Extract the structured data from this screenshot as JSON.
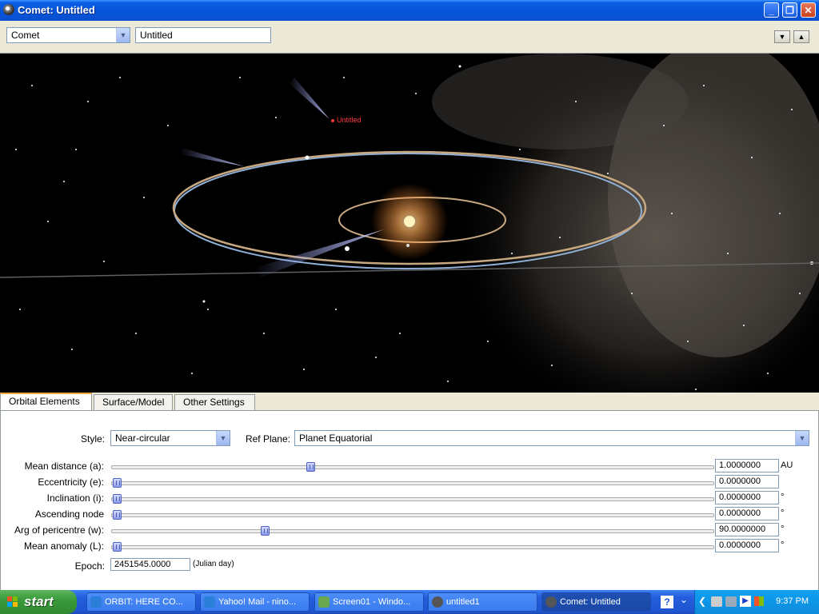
{
  "window": {
    "title": "Comet: Untitled"
  },
  "toolbar": {
    "type_value": "Comet",
    "name_value": "Untitled"
  },
  "viewport": {
    "comet_label": "Untitled"
  },
  "tabs": [
    "Orbital Elements",
    "Surface/Model",
    "Other Settings"
  ],
  "panel": {
    "style_label": "Style:",
    "style_value": "Near-circular",
    "ref_plane_label": "Ref Plane:",
    "ref_plane_value": "Planet Equatorial",
    "elements": [
      {
        "label": "Mean distance (a):",
        "value": "1.0000000",
        "unit": "AU",
        "slider_fraction": 0.327
      },
      {
        "label": "Eccentricity (e):",
        "value": "0.0000000",
        "unit": "",
        "slider_fraction": 0.0
      },
      {
        "label": "Inclination (i):",
        "value": "0.0000000",
        "unit": "°",
        "slider_fraction": 0.0
      },
      {
        "label": "Ascending node",
        "value": "0.0000000",
        "unit": "°",
        "slider_fraction": 0.0
      },
      {
        "label": "Arg of pericentre (w):",
        "value": "90.0000000",
        "unit": "°",
        "slider_fraction": 0.25
      },
      {
        "label": "Mean anomaly (L):",
        "value": "0.0000000",
        "unit": "°",
        "slider_fraction": 0.0
      }
    ],
    "epoch_label": "Epoch:",
    "epoch_value": "2451545.0000",
    "epoch_unit": "(Julian day)"
  },
  "taskbar": {
    "start_label": "start",
    "tasks": [
      "ORBIT: HERE CO...",
      "Yahoo! Mail - nino...",
      "Screen01 - Windo...",
      "untitled1",
      "Comet: Untitled"
    ],
    "clock": "9:37 PM"
  },
  "colors": {
    "orbit_blue": "#8fb0d8",
    "orbit_tan": "#c8a880",
    "sun": "#fff3c0",
    "comet_label": "#ff3a3a"
  }
}
